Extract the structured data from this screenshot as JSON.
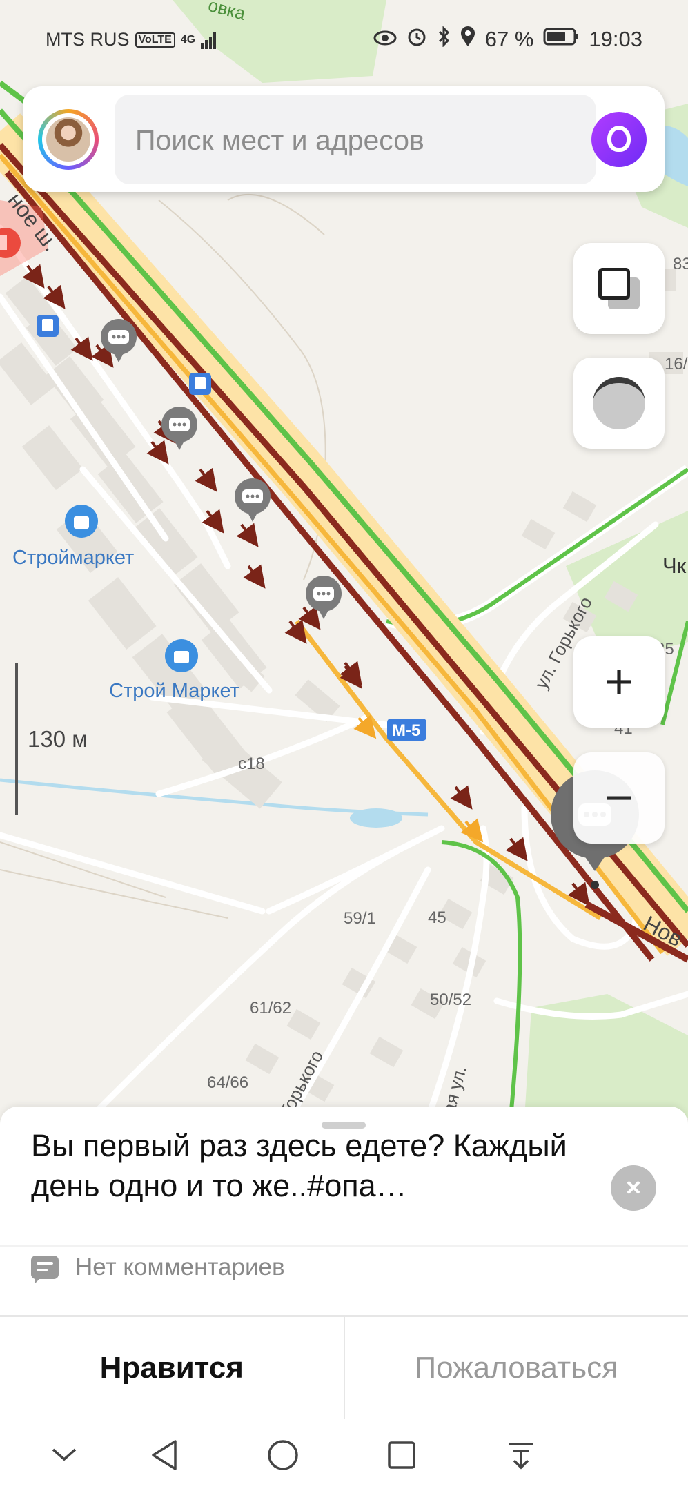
{
  "status_bar": {
    "carrier": "MTS RUS",
    "volte": "VoLTE",
    "network": "4G",
    "battery": "67 %",
    "time": "19:03"
  },
  "search": {
    "placeholder": "Поиск мест и адресов"
  },
  "map": {
    "labels": {
      "store1": "Строймаркет",
      "store2": "Строй Маркет",
      "road_m5": "М-5",
      "street_gorkogo": "ул. Горького",
      "street_gorkogo_partial": "Горького",
      "street_partial_bottom": "ая ул.",
      "road_nov": "Нов",
      "road_top_partial": "ное ш.",
      "top_partial": "овка",
      "chk_partial": "Чк",
      "bld_c18": "с18",
      "bld_59_1": "59/1",
      "bld_45": "45",
      "bld_61_62": "61/62",
      "bld_50_52": "50/52",
      "bld_64_66": "64/66",
      "bld_35": "35",
      "bld_41": "41",
      "bld_83": "83",
      "bld_16": "16/"
    },
    "scale_label": "130 м",
    "colors": {
      "jam": "#8b2a1e",
      "slow": "#f6b73c",
      "free": "#5fc349",
      "road": "#fde3a7",
      "water": "#b3dcee"
    }
  },
  "controls": {
    "layers_icon": "layers-icon",
    "traffic_icon": "traffic-icon",
    "zoom_in": "+",
    "zoom_out": "−"
  },
  "sheet": {
    "title": "Вы первый раз здесь едете? Каждый день одно и то же..#опа…",
    "close": "×",
    "comments": "Нет комментариев",
    "like": "Нравится",
    "report": "Пожаловаться"
  },
  "navbar": {
    "items": [
      "chevron-down-icon",
      "back-icon",
      "home-icon",
      "recents-icon",
      "notifications-icon"
    ]
  }
}
